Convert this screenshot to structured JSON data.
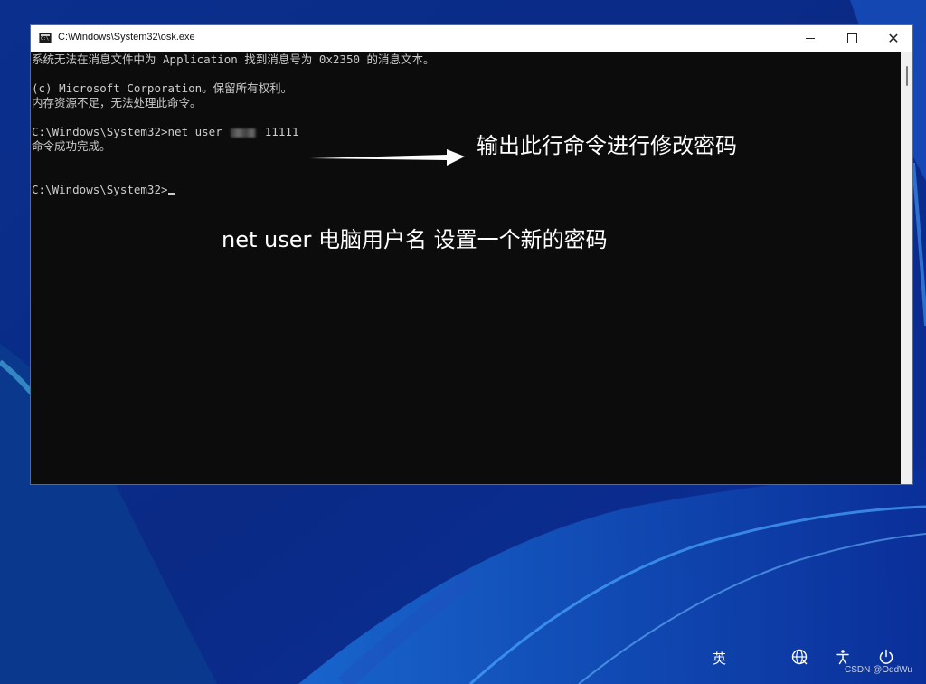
{
  "colors": {
    "console_bg": "#0c0c0c",
    "console_text": "#cccccc",
    "annotation_text": "#ffffff",
    "wallpaper_base": "#0b2a8a"
  },
  "window": {
    "title": "C:\\Windows\\System32\\osk.exe",
    "icon": "console-icon",
    "minimize_label": "—",
    "maximize_label": "□",
    "close_label": "✕"
  },
  "console": {
    "lines": [
      "系统无法在消息文件中为 Application 找到消息号为 0x2350 的消息文本。",
      "(c) Microsoft Corporation。保留所有权利。",
      "内存资源不足，无法处理此命令。",
      "C:\\Windows\\System32>net user",
      "11111",
      "命令成功完成。",
      "C:\\Windows\\System32>"
    ]
  },
  "annotations": {
    "arrow_note": "输出此行命令进行修改密码",
    "usage_note": "net  user  电脑用户名  设置一个新的密码"
  },
  "tray": {
    "ime_label": "英",
    "network_icon": "globe-network-icon",
    "accessibility_icon": "accessibility-icon",
    "power_icon": "power-icon"
  },
  "watermark": "CSDN @OddWu"
}
